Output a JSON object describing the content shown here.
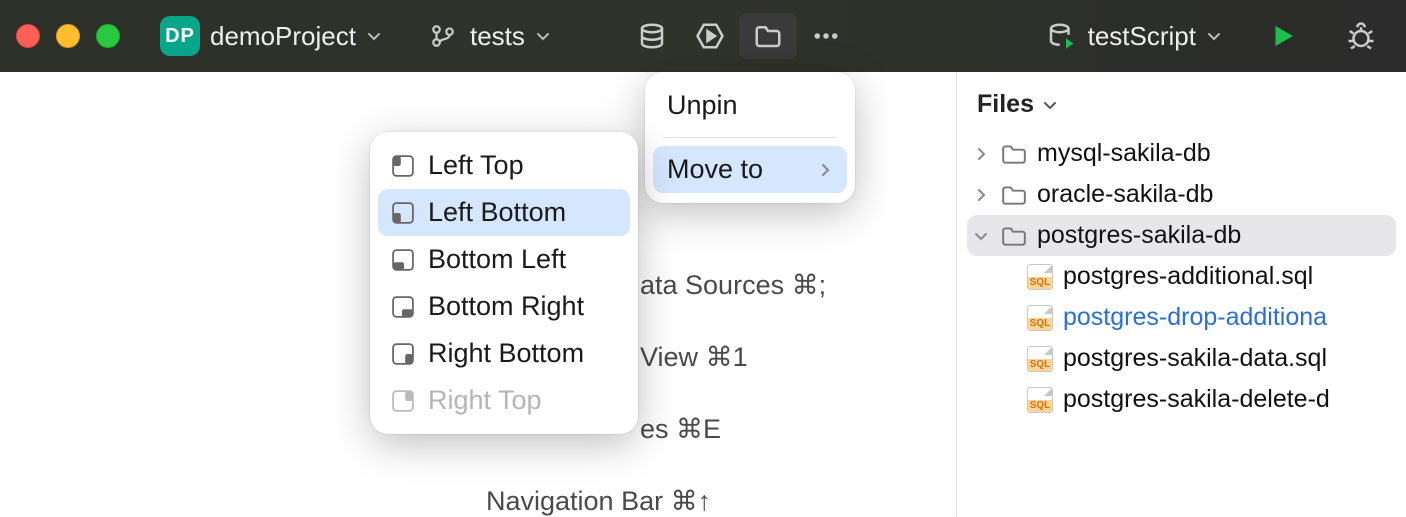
{
  "titlebar": {
    "project_badge": "DP",
    "project_name": "demoProject",
    "branch_name": "tests",
    "run_config": "testScript"
  },
  "context_menu": {
    "unpin": "Unpin",
    "move_to": "Move to"
  },
  "move_submenu": {
    "items": [
      {
        "label": "Left Top",
        "state": "normal"
      },
      {
        "label": "Left Bottom",
        "state": "highlight"
      },
      {
        "label": "Bottom Left",
        "state": "normal"
      },
      {
        "label": "Bottom Right",
        "state": "normal"
      },
      {
        "label": "Right Bottom",
        "state": "normal"
      },
      {
        "label": "Right Top",
        "state": "disabled"
      }
    ]
  },
  "editor_hints": {
    "line1_text": "ata Sources",
    "line1_shortcut": "⌘;",
    "line2_text": "View",
    "line2_shortcut": "⌘1",
    "line3_text": "es",
    "line3_shortcut": "⌘E",
    "navbar_text": "Navigation Bar",
    "navbar_shortcut": "⌘↑"
  },
  "files_panel": {
    "title": "Files",
    "tree": [
      {
        "type": "folder",
        "label": "mysql-sakila-db",
        "expanded": false
      },
      {
        "type": "folder",
        "label": "oracle-sakila-db",
        "expanded": false
      },
      {
        "type": "folder",
        "label": "postgres-sakila-db",
        "expanded": true,
        "selected": true
      }
    ],
    "children": [
      {
        "label": "postgres-additional.sql",
        "link": false
      },
      {
        "label": "postgres-drop-additiona",
        "link": true
      },
      {
        "label": "postgres-sakila-data.sql",
        "link": false
      },
      {
        "label": "postgres-sakila-delete-d",
        "link": false
      }
    ]
  },
  "icons": {
    "sql_tag": "SQL"
  }
}
